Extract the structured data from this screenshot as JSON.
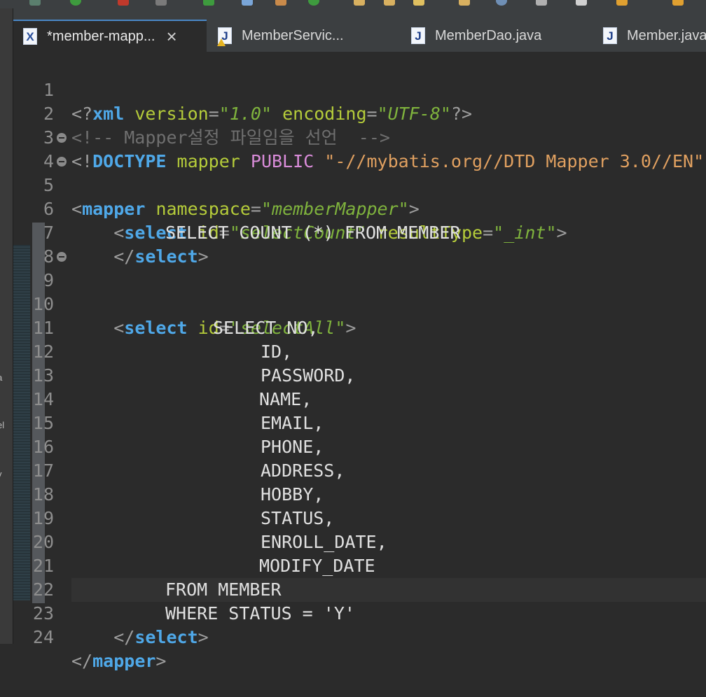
{
  "tabs": [
    {
      "label": "*member-mapp...",
      "icon": "xml-file-icon",
      "active": true
    },
    {
      "label": "MemberServic...",
      "icon": "java-file-icon",
      "warning": true
    },
    {
      "label": "MemberDao.java",
      "icon": "java-file-icon"
    },
    {
      "label": "Member.java",
      "icon": "java-file-icon"
    }
  ],
  "left_strip": [
    "a",
    "el",
    "v"
  ],
  "code": {
    "line1": {
      "num": "1",
      "open": "<?",
      "tag": "xml",
      "a1": "version",
      "eq1": "=",
      "v1": "1.0",
      "a2": "encoding",
      "eq2": "=",
      "v2": "UTF-8",
      "close": "?>"
    },
    "line2": {
      "num": "2",
      "comment": "<!-- Mapper설정 파일임을 선언  -->"
    },
    "line3": {
      "num": "3",
      "open": "<!",
      "kw": "DOCTYPE",
      "name": "mapper",
      "pub": "PUBLIC",
      "str": "\"-//mybatis.org//DTD Mapper 3.0//EN\""
    },
    "line4": {
      "num": "4",
      "tag": "mapper",
      "attr": "namespace",
      "val": "memberMapper"
    },
    "line5": {
      "num": "5",
      "tag": "select",
      "a1": "id",
      "v1": "selectCount",
      "a2": "resultType",
      "v2": "_int"
    },
    "line6": {
      "num": "6",
      "sql": "SELECT COUNT (*) FROM MEMBER"
    },
    "line7": {
      "num": "7",
      "tag": "select"
    },
    "line8": {
      "num": "8"
    },
    "line9": {
      "num": "9",
      "tag": "select",
      "a1": "id",
      "v1": "selectAll"
    },
    "line10": {
      "num": "10",
      "sql": "SELECT NO,"
    },
    "line11": {
      "num": "11",
      "sql": "ID,"
    },
    "line12": {
      "num": "12",
      "sql": "PASSWORD,"
    },
    "line13": {
      "num": "13",
      "sql": "NAME,"
    },
    "line14": {
      "num": "14",
      "sql": "EMAIL,"
    },
    "line15": {
      "num": "15",
      "sql": "PHONE,"
    },
    "line16": {
      "num": "16",
      "sql": "ADDRESS,"
    },
    "line17": {
      "num": "17",
      "sql": "HOBBY,"
    },
    "line18": {
      "num": "18",
      "sql": "STATUS,"
    },
    "line19": {
      "num": "19",
      "sql": "ENROLL_DATE,"
    },
    "line20": {
      "num": "20",
      "sql": "MODIFY_DATE"
    },
    "line21": {
      "num": "21",
      "sql": "FROM MEMBER"
    },
    "line22": {
      "num": "22",
      "sql": "WHERE STATUS = 'Y'"
    },
    "line23": {
      "num": "23",
      "tag": "select"
    },
    "line24": {
      "num": "24",
      "tag": "mapper"
    }
  },
  "colors": {
    "background": "#2b2b2b",
    "tag": "#4fa8e8",
    "attribute": "#b5cc3a",
    "string": "#7fb33d",
    "comment": "#6f6f6f"
  }
}
